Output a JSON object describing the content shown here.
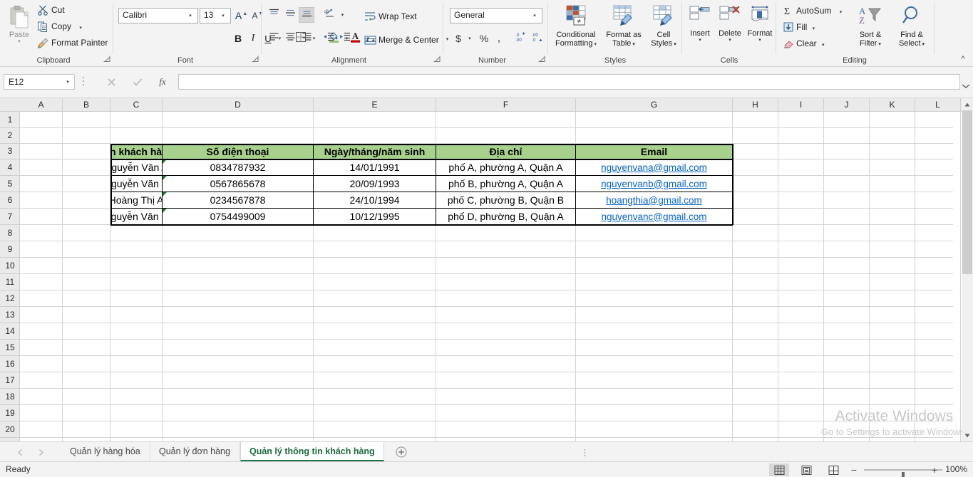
{
  "ribbon": {
    "groups": [
      {
        "label": "Clipboard"
      },
      {
        "label": "Font"
      },
      {
        "label": "Alignment"
      },
      {
        "label": "Number"
      },
      {
        "label": "Styles"
      },
      {
        "label": "Cells"
      },
      {
        "label": "Editing"
      }
    ],
    "clipboard": {
      "paste_label": "Paste",
      "cut_label": "Cut",
      "copy_label": "Copy",
      "format_painter_label": "Format Painter"
    },
    "font": {
      "font_name": "Calibri",
      "font_size": "13",
      "bold_label": "B",
      "italic_label": "I",
      "underline_label": "U",
      "grow_font_label": "A",
      "shrink_font_label": "A"
    },
    "alignment": {
      "wrap_text_label": "Wrap Text",
      "merge_center_label": "Merge & Center"
    },
    "number": {
      "format_value": "General",
      "currency_label": "$",
      "percent_label": "%",
      "comma_label": ","
    },
    "styles": {
      "conditional_formatting_label": "Conditional\nFormatting",
      "conditional_formatting_l1": "Conditional",
      "conditional_formatting_l2": "Formatting",
      "format_as_table_l1": "Format as",
      "format_as_table_l2": "Table",
      "cell_styles_l1": "Cell",
      "cell_styles_l2": "Styles"
    },
    "cells": {
      "insert_label": "Insert",
      "delete_label": "Delete",
      "format_label": "Format"
    },
    "editing": {
      "autosum_label": "AutoSum",
      "fill_label": "Fill",
      "clear_label": "Clear",
      "sort_filter_l1": "Sort &",
      "sort_filter_l2": "Filter",
      "find_select_l1": "Find &",
      "find_select_l2": "Select"
    }
  },
  "formula_bar": {
    "name_box_value": "E12",
    "formula_value": "",
    "cancel_icon": "cancel-icon",
    "enter_icon": "check-icon",
    "fx_label": "fx"
  },
  "grid": {
    "columns": [
      "A",
      "B",
      "C",
      "D",
      "E",
      "F",
      "G",
      "H",
      "I",
      "J",
      "K",
      "L"
    ],
    "rows": [
      "1",
      "2",
      "3",
      "4",
      "5",
      "6",
      "7",
      "8",
      "9",
      "10",
      "11",
      "12",
      "13",
      "14",
      "15",
      "16",
      "17",
      "18",
      "19",
      "20"
    ]
  },
  "table": {
    "headers": [
      "Tên khách hàng",
      "Số điện thoại",
      "Ngày/tháng/năm sinh",
      "Địa chỉ",
      "Email"
    ],
    "rows": [
      {
        "name": "Nguyễn Văn A",
        "phone": "0834787932",
        "dob": "14/01/1991",
        "address": "phố A, phường A, Quận A",
        "email": "nguyenvana@gmail.com"
      },
      {
        "name": "Nguyễn Văn B",
        "phone": "0567865678",
        "dob": "20/09/1993",
        "address": "phố B, phường A, Quận A",
        "email": "nguyenvanb@gmail.com"
      },
      {
        "name": "Hoàng Thị A",
        "phone": "0234567878",
        "dob": "24/10/1994",
        "address": "phố C, phường B, Quận B",
        "email": "hoangthia@gmail.com"
      },
      {
        "name": "Nguyễn Văn C",
        "phone": "0754499009",
        "dob": "10/12/1995",
        "address": "phố D, phường B, Quận A",
        "email": "nguyenvanc@gmail.com"
      }
    ],
    "header_bg": "#A9D18E",
    "link_color": "#0563C1"
  },
  "sheet_tabs": {
    "tabs": [
      {
        "label": "Quản lý hàng hóa",
        "active": false
      },
      {
        "label": "Quản lý đơn hàng",
        "active": false
      },
      {
        "label": "Quản lý thông tin khách hàng",
        "active": true
      }
    ],
    "add_sheet_label": "+"
  },
  "status_bar": {
    "status": "Ready",
    "zoom": "100%",
    "zoom_out_label": "−",
    "zoom_in_label": "+",
    "views": [
      "normal-view",
      "page-layout-view",
      "page-break-view"
    ]
  },
  "watermark": {
    "line1": "Activate Windows",
    "line2": "Go to Settings to activate Windows."
  }
}
